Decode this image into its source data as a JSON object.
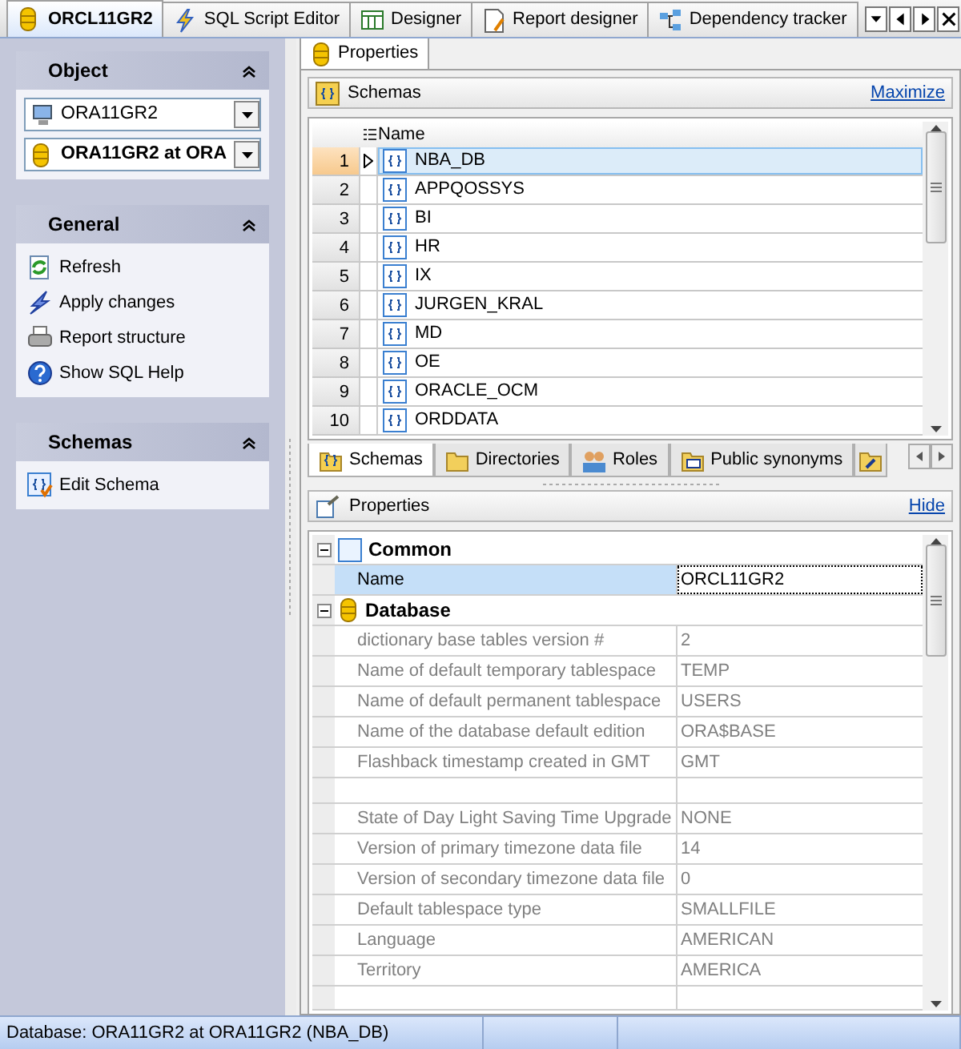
{
  "doc_tabs": [
    {
      "label": "ORCL11GR2",
      "selected": true
    },
    {
      "label": "SQL Script Editor",
      "selected": false
    },
    {
      "label": "Designer",
      "selected": false
    },
    {
      "label": "Report designer",
      "selected": false
    },
    {
      "label": "Dependency tracker",
      "selected": false
    }
  ],
  "sidebar": {
    "sections": [
      {
        "title": "Object",
        "kind": "selectors",
        "selectors": [
          {
            "value": "ORA11GR2",
            "bold": false
          },
          {
            "value": "ORA11GR2 at ORA",
            "bold": true
          }
        ]
      },
      {
        "title": "General",
        "kind": "actions",
        "items": [
          "Refresh",
          "Apply changes",
          "Report structure",
          "Show SQL Help"
        ]
      },
      {
        "title": "Schemas",
        "kind": "actions",
        "items": [
          "Edit Schema"
        ]
      }
    ]
  },
  "page_tabs": [
    {
      "label": "Properties",
      "selected": true
    }
  ],
  "schemas_panel": {
    "title": "Schemas",
    "link": "Maximize",
    "column": "Name",
    "rows": [
      {
        "num": "1",
        "name": "NBA_DB",
        "selected": true
      },
      {
        "num": "2",
        "name": "APPQOSSYS",
        "selected": false
      },
      {
        "num": "3",
        "name": "BI",
        "selected": false
      },
      {
        "num": "4",
        "name": "HR",
        "selected": false
      },
      {
        "num": "5",
        "name": "IX",
        "selected": false
      },
      {
        "num": "6",
        "name": "JURGEN_KRAL",
        "selected": false
      },
      {
        "num": "7",
        "name": "MD",
        "selected": false
      },
      {
        "num": "8",
        "name": "OE",
        "selected": false
      },
      {
        "num": "9",
        "name": "ORACLE_OCM",
        "selected": false
      },
      {
        "num": "10",
        "name": "ORDDATA",
        "selected": false
      }
    ]
  },
  "object_tabs": [
    {
      "label": "Schemas",
      "selected": true
    },
    {
      "label": "Directories",
      "selected": false
    },
    {
      "label": "Roles",
      "selected": false
    },
    {
      "label": "Public synonyms",
      "selected": false
    }
  ],
  "properties_panel": {
    "title": "Properties",
    "link": "Hide",
    "groups": [
      {
        "title": "Common",
        "expanded": true,
        "rows": [
          {
            "label": "Name",
            "value": "ORCL11GR2",
            "selected": true,
            "disabled": false
          }
        ]
      },
      {
        "title": "Database",
        "expanded": true,
        "rows": [
          {
            "label": "dictionary base tables version #",
            "value": "2",
            "selected": false,
            "disabled": true
          },
          {
            "label": "Name of default temporary tablespace",
            "value": "TEMP",
            "selected": false,
            "disabled": true
          },
          {
            "label": "Name of default permanent tablespace",
            "value": "USERS",
            "selected": false,
            "disabled": true
          },
          {
            "label": "Name of the database default edition",
            "value": "ORA$BASE",
            "selected": false,
            "disabled": true
          },
          {
            "label": "Flashback timestamp created in GMT",
            "value": "GMT",
            "selected": false,
            "disabled": true
          },
          {
            "label": "",
            "value": ""
          },
          {
            "label": "State of Day Light Saving Time Upgrade",
            "value": "NONE",
            "selected": false,
            "disabled": true
          },
          {
            "label": "Version of primary timezone data file",
            "value": "14",
            "selected": false,
            "disabled": true
          },
          {
            "label": "Version of secondary timezone data file",
            "value": "0",
            "selected": false,
            "disabled": true
          },
          {
            "label": "Default tablespace type",
            "value": "SMALLFILE",
            "selected": false,
            "disabled": true
          },
          {
            "label": "Language",
            "value": "AMERICAN",
            "selected": false,
            "disabled": true
          },
          {
            "label": "Territory",
            "value": "AMERICA",
            "selected": false,
            "disabled": true
          }
        ]
      }
    ]
  },
  "status_bar": {
    "text": "Database: ORA11GR2 at ORA11GR2 (NBA_DB)"
  }
}
